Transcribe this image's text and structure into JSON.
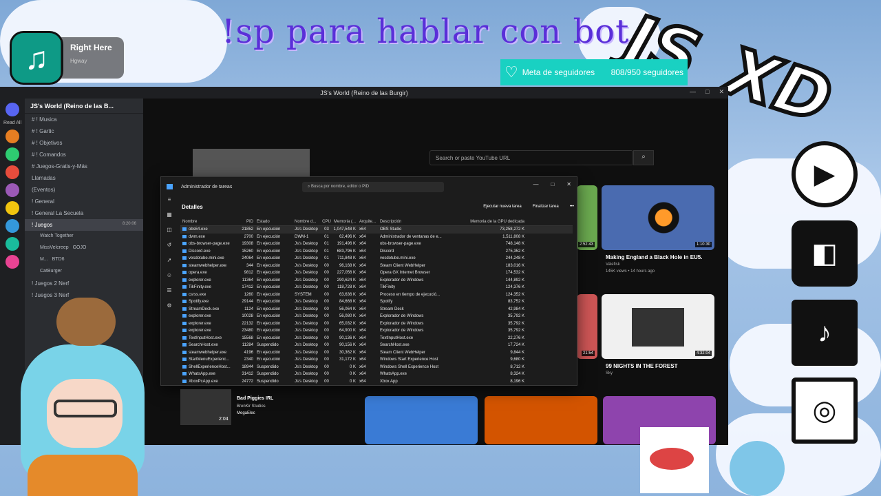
{
  "banner": {
    "text": "!sp para hablar con bot",
    "logo_text": "JS_XD"
  },
  "music": {
    "title": "Right Here",
    "artist": "Hgway",
    "icon": "music-note-icon"
  },
  "goal": {
    "label": "Meta de seguidores",
    "progress": "808/950 seguidores",
    "current": 808,
    "target": 950
  },
  "social": [
    "youtube-icon",
    "twitch-icon",
    "tiktok-icon",
    "instagram-icon"
  ],
  "discord": {
    "window_title": "JS's World (Reino de las Burgir)",
    "read_all": "Read All",
    "guild_name": "JS's World (Reino de las B...",
    "channels": [
      {
        "label": "# ! Musica"
      },
      {
        "label": "# ! Gartic"
      },
      {
        "label": "# ! Objetivos"
      },
      {
        "label": "# ! Comandos"
      },
      {
        "label": "# Juegos-Gratis-y-Más"
      },
      {
        "label": "Llamadas"
      },
      {
        "label": "(Eventos)"
      },
      {
        "label": "! General"
      },
      {
        "label": "! General La Secuela"
      },
      {
        "label": "! Juegos",
        "time": "8:20:06"
      },
      {
        "label": "Watch Together"
      },
      {
        "label": "MissVelcreep",
        "badge": "GOJO"
      },
      {
        "label": "M...",
        "badge": "BTD6"
      },
      {
        "label": "CatBurger"
      },
      {
        "label": "! Juegos 2 Nerf"
      },
      {
        "label": "! Juegos 3 Nerf"
      }
    ]
  },
  "youtube": {
    "search_placeholder": "Search or paste YouTube URL",
    "videos": [
      {
        "title": "Making England a Black Hole in EU5.",
        "channel": "Valefisk",
        "meta": "145K views • 14 hours ago",
        "duration": "1:10:30"
      },
      {
        "title": "99 NIGHTS IN THE FOREST",
        "channel": "Sky",
        "meta": "",
        "duration": "4:32:04"
      },
      {
        "duration": "2:52:43"
      },
      {
        "duration": "21:54"
      }
    ],
    "mini_player": {
      "title": "Bad Piggies IRL",
      "artist": "BrenKir Studios",
      "user": "MegaElec",
      "time": "2:04"
    }
  },
  "taskmgr": {
    "title": "Administrador de tareas",
    "search_placeholder": "Busca por nombre, editor o PID",
    "section": "Detalles",
    "run_task": "Ejecutar nueva tarea",
    "end_task": "Finalizar tarea",
    "more": "•••",
    "columns": [
      "Nombre",
      "PID",
      "Estado",
      "Nombre d...",
      "CPU",
      "Memoria (...",
      "Arquite...",
      "Descripción",
      "Memoria de la GPU dedicada"
    ],
    "rows": [
      [
        "obs64.exe",
        "21852",
        "En ejecución",
        "Js's Desktop",
        "03",
        "1,047,548 K",
        "x64",
        "OBS Studio",
        "73,258,272 K"
      ],
      [
        "dwm.exe",
        "2700",
        "En ejecución",
        "DWM-1",
        "01",
        "62,496 K",
        "x64",
        "Administrador de ventanas de e...",
        "1,511,808 K"
      ],
      [
        "obs-browser-page.exe",
        "19308",
        "En ejecución",
        "Js's Desktop",
        "01",
        "191,496 K",
        "x64",
        "obs-browser-page.exe",
        "748,148 K"
      ],
      [
        "Discord.exe",
        "15260",
        "En ejecución",
        "Js's Desktop",
        "01",
        "683,796 K",
        "x64",
        "Discord",
        "275,352 K"
      ],
      [
        "vesdotube.mini.exe",
        "24064",
        "En ejecución",
        "Js's Desktop",
        "01",
        "711,848 K",
        "x64",
        "vesdotube.mini.exe",
        "244,248 K"
      ],
      [
        "steamwebhelper.exe",
        "344",
        "En ejecución",
        "Js's Desktop",
        "00",
        "96,168 K",
        "x64",
        "Steam Client WebHelper",
        "183,016 K"
      ],
      [
        "opera.exe",
        "9812",
        "En ejecución",
        "Js's Desktop",
        "00",
        "227,056 K",
        "x64",
        "Opera GX Internet Browser",
        "174,532 K"
      ],
      [
        "explorer.exe",
        "11364",
        "En ejecución",
        "Js's Desktop",
        "00",
        "290,624 K",
        "x64",
        "Explorador de Windows",
        "144,892 K"
      ],
      [
        "TikFinity.exe",
        "17412",
        "En ejecución",
        "Js's Desktop",
        "00",
        "118,728 K",
        "x64",
        "TikFinity",
        "124,376 K"
      ],
      [
        "csrss.exe",
        "1260",
        "En ejecución",
        "SYSTEM",
        "00",
        "63,636 K",
        "x64",
        "Proceso en tiempo de ejecució...",
        "124,352 K"
      ],
      [
        "Spotify.exe",
        "29144",
        "En ejecución",
        "Js's Desktop",
        "00",
        "84,668 K",
        "x64",
        "Spotify",
        "83,752 K"
      ],
      [
        "StreamDeck.exe",
        "1124",
        "En ejecución",
        "Js's Desktop",
        "00",
        "56,064 K",
        "x64",
        "Stream Deck",
        "42,984 K"
      ],
      [
        "explorer.exe",
        "10028",
        "En ejecución",
        "Js's Desktop",
        "00",
        "56,080 K",
        "x64",
        "Explorador de Windows",
        "35,792 K"
      ],
      [
        "explorer.exe",
        "22132",
        "En ejecución",
        "Js's Desktop",
        "00",
        "65,032 K",
        "x64",
        "Explorador de Windows",
        "35,792 K"
      ],
      [
        "explorer.exe",
        "23480",
        "En ejecución",
        "Js's Desktop",
        "00",
        "64,900 K",
        "x64",
        "Explorador de Windows",
        "35,792 K"
      ],
      [
        "TextInputHost.exe",
        "15568",
        "En ejecución",
        "Js's Desktop",
        "00",
        "90,136 K",
        "x64",
        "TextInputHost.exe",
        "22,276 K"
      ],
      [
        "SearchHost.exe",
        "11284",
        "Suspendido",
        "Js's Desktop",
        "00",
        "90,156 K",
        "x64",
        "SearchHost.exe",
        "17,724 K"
      ],
      [
        "steamwebhelper.exe",
        "4196",
        "En ejecución",
        "Js's Desktop",
        "00",
        "30,362 K",
        "x64",
        "Steam Client WebHelper",
        "9,844 K"
      ],
      [
        "StartMenuExperienc...",
        "2340",
        "En ejecución",
        "Js's Desktop",
        "00",
        "31,172 K",
        "x64",
        "Windows Start Experience Host",
        "9,680 K"
      ],
      [
        "ShellExperienceHost...",
        "18944",
        "Suspendido",
        "Js's Desktop",
        "00",
        "0 K",
        "x64",
        "Windows Shell Experience Host",
        "8,712 K"
      ],
      [
        "WhatsApp.exe",
        "31412",
        "Suspendido",
        "Js's Desktop",
        "00",
        "0 K",
        "x64",
        "WhatsApp.exe",
        "8,324 K"
      ],
      [
        "XboxPcApp.exe",
        "24772",
        "Suspendido",
        "Js's Desktop",
        "00",
        "0 K",
        "x64",
        "Xbox App",
        "8,196 K"
      ]
    ]
  },
  "colors": {
    "goal_bg": "#19d1c2",
    "banner": "#5a2fd8",
    "discord_bg": "#2b2d31",
    "taskmgr_bg": "#1c1c1c"
  }
}
